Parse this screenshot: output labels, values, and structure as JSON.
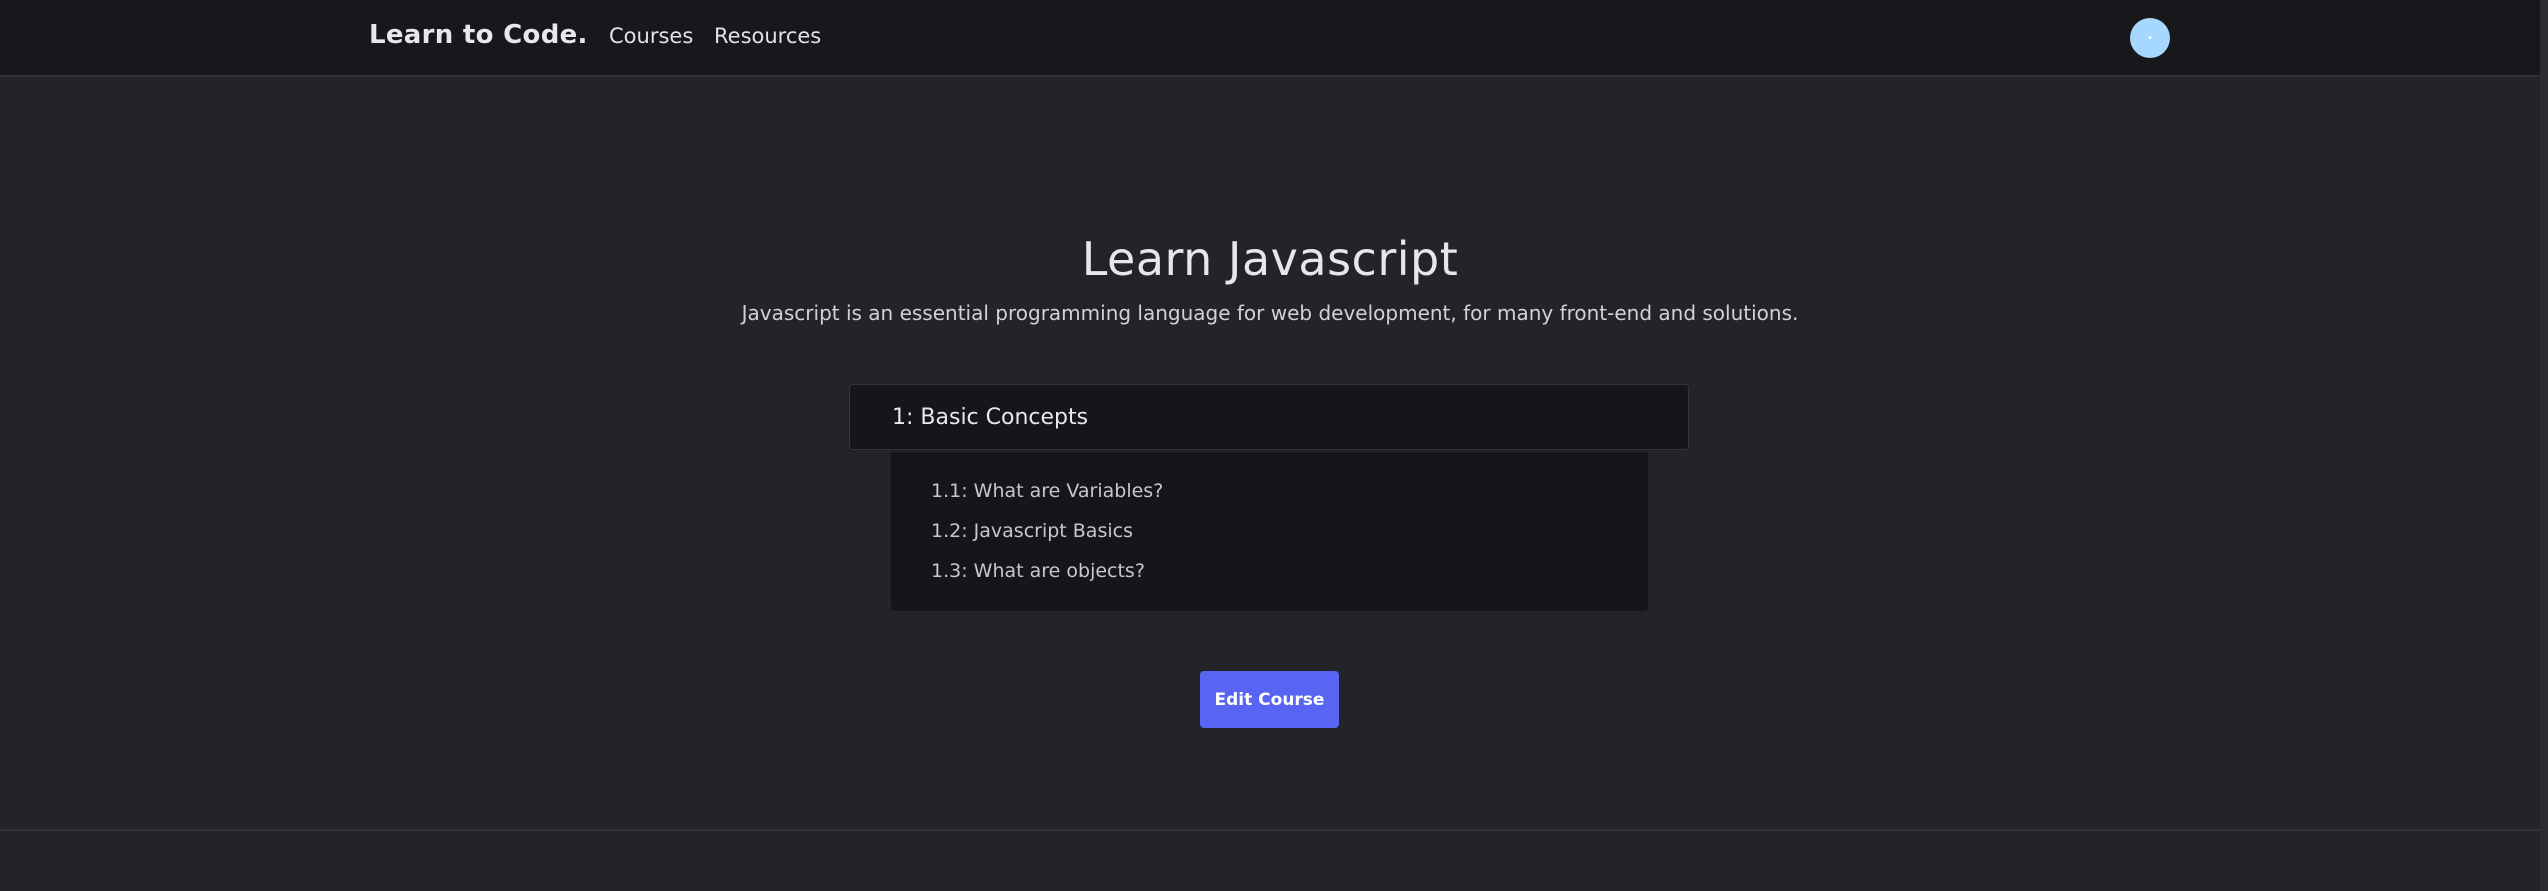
{
  "navbar": {
    "brand": "Learn to Code.",
    "links": [
      "Courses",
      "Resources"
    ],
    "avatar_color": "#a6d8ff"
  },
  "course": {
    "title": "Learn Javascript",
    "description": "Javascript is an essential programming language for web development, for many front-end and solutions.",
    "modules": [
      {
        "title": "1: Basic Concepts",
        "lessons": [
          "1.1: What are Variables?",
          "1.2: Javascript Basics",
          "1.3: What are objects?"
        ]
      }
    ],
    "edit_label": "Edit Course"
  },
  "colors": {
    "background": "#232429",
    "navbar": "#18181c",
    "accent": "#5865f2"
  }
}
